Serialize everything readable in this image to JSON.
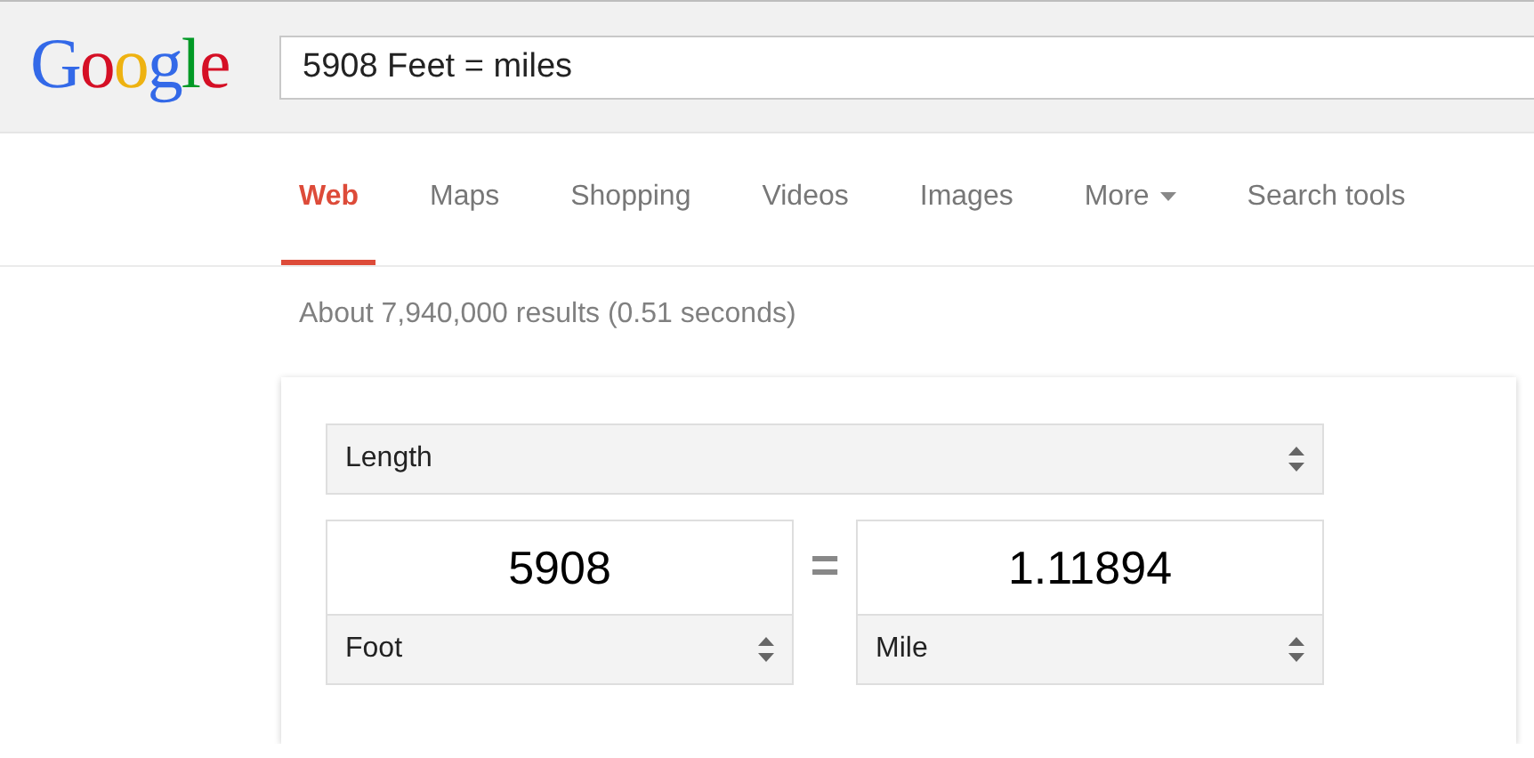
{
  "logo": {
    "text": "Google"
  },
  "search": {
    "value": "5908 Feet = miles"
  },
  "tabs": [
    {
      "label": "Web",
      "selected": true,
      "kind": "tab"
    },
    {
      "label": "Maps",
      "selected": false,
      "kind": "tab"
    },
    {
      "label": "Shopping",
      "selected": false,
      "kind": "tab"
    },
    {
      "label": "Videos",
      "selected": false,
      "kind": "tab"
    },
    {
      "label": "Images",
      "selected": false,
      "kind": "tab"
    },
    {
      "label": "More",
      "selected": false,
      "kind": "dropdown"
    },
    {
      "label": "Search tools",
      "selected": false,
      "kind": "tab"
    }
  ],
  "result_stats": "About 7,940,000 results (0.51 seconds)",
  "converter": {
    "quantity": "Length",
    "equals": "=",
    "from": {
      "value": "5908",
      "unit": "Foot"
    },
    "to": {
      "value": "1.11894",
      "unit": "Mile"
    }
  }
}
